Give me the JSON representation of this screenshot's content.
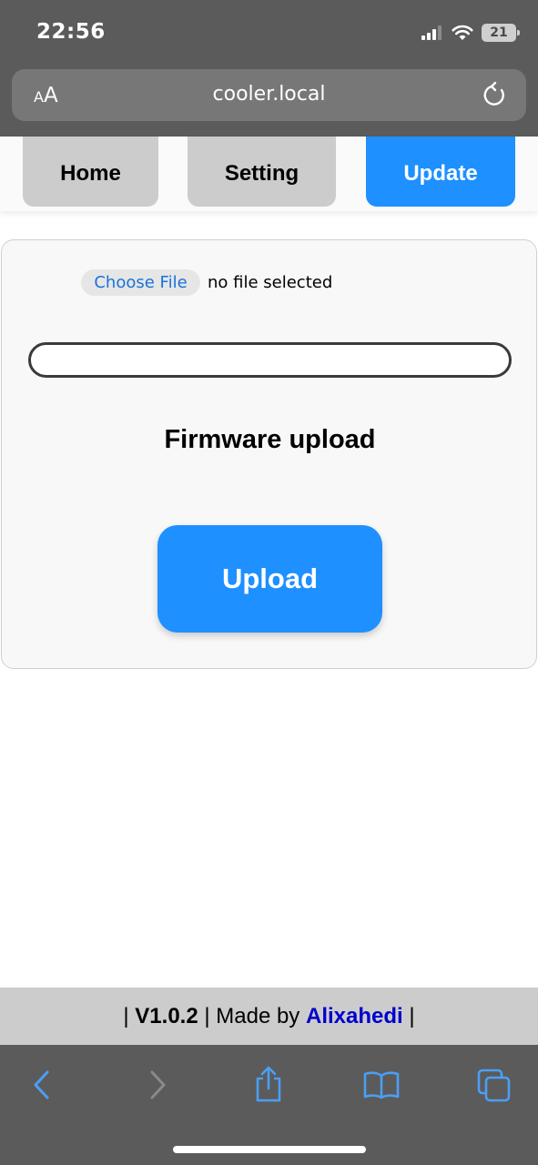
{
  "status_bar": {
    "time": "22:56",
    "battery": "21",
    "icons": [
      "signal-icon",
      "wifi-icon",
      "battery-icon"
    ]
  },
  "address_bar": {
    "text_size_small": "A",
    "text_size_large": "A",
    "url": "cooler.local",
    "reload_icon": "reload-icon"
  },
  "nav": {
    "tabs": [
      {
        "label": "Home",
        "active": false
      },
      {
        "label": "Setting",
        "active": false
      },
      {
        "label": "Update",
        "active": true
      }
    ]
  },
  "upload_card": {
    "choose_file_label": "Choose File",
    "file_status": "no file selected",
    "progress": 0,
    "title": "Firmware upload",
    "upload_label": "Upload"
  },
  "footer": {
    "sep_left": "| ",
    "version": "V1.0.2",
    "made_by": " | Made by ",
    "author": "Alixahedi",
    "sep_right": " |"
  },
  "toolbar": {
    "icons": [
      "back-icon",
      "forward-icon",
      "share-icon",
      "bookmarks-icon",
      "tabs-icon"
    ]
  },
  "colors": {
    "accent": "#1e90ff",
    "tab_inactive": "#cccccc",
    "author_link": "#0000cd",
    "browser_chrome": "#5b5b5b"
  }
}
